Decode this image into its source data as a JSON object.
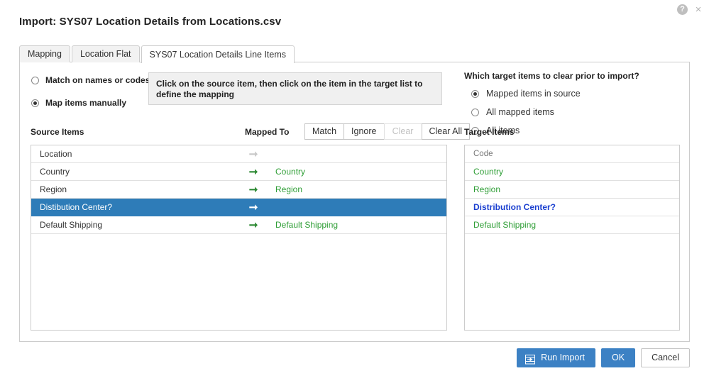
{
  "window": {
    "help_icon": "help-icon",
    "help_glyph": "?",
    "close_icon": "close-icon",
    "close_glyph": "×"
  },
  "dialog": {
    "title": "Import: SYS07 Location Details from Locations.csv"
  },
  "tabs": [
    {
      "label": "Mapping",
      "active": false
    },
    {
      "label": "Location Flat",
      "active": false
    },
    {
      "label": "SYS07 Location Details Line Items",
      "active": true
    }
  ],
  "mapping_mode": {
    "options": [
      {
        "label": "Match on names or codes",
        "selected": false
      },
      {
        "label": "Map items manually",
        "selected": true
      }
    ]
  },
  "hint": {
    "text": "Click on the source item, then click on the item in the target list to define the mapping"
  },
  "clear_options": {
    "question": "Which target items to clear prior to import?",
    "options": [
      {
        "label": "Mapped items in source",
        "selected": true
      },
      {
        "label": "All mapped items",
        "selected": false
      },
      {
        "label": "All items",
        "selected": false
      }
    ]
  },
  "columns": {
    "source_items": "Source Items",
    "mapped_to": "Mapped To",
    "target_items": "Target Items"
  },
  "map_buttons": [
    {
      "label": "Match",
      "disabled": false
    },
    {
      "label": "Ignore",
      "disabled": false
    },
    {
      "label": "Clear",
      "disabled": true
    },
    {
      "label": "Clear All",
      "disabled": false
    }
  ],
  "source_list": {
    "rows": [
      {
        "name": "Location",
        "arrow": "muted",
        "mapped": ""
      },
      {
        "name": "Country",
        "arrow": "green",
        "mapped": "Country"
      },
      {
        "name": "Region",
        "arrow": "green",
        "mapped": "Region"
      },
      {
        "name": "Distibution Center?",
        "arrow": "white",
        "mapped": "",
        "selected": true
      },
      {
        "name": "Default Shipping",
        "arrow": "green",
        "mapped": "Default Shipping"
      }
    ]
  },
  "target_list": {
    "header": "Code",
    "rows": [
      {
        "name": "Country",
        "highlight": false
      },
      {
        "name": "Region",
        "highlight": false
      },
      {
        "name": "Distribution Center?",
        "highlight": true
      },
      {
        "name": "Default Shipping",
        "highlight": false
      }
    ]
  },
  "footer": {
    "run_import": "Run Import",
    "run_import_icon": "import-icon",
    "ok": "OK",
    "cancel": "Cancel"
  },
  "colors": {
    "accent_blue": "#3c81c4",
    "selection_blue": "#2e7cb8",
    "mapped_green": "#2f9e36",
    "target_highlight_blue": "#1a3fd0",
    "panel_border": "#cccccc",
    "hint_bg": "#f0f0f0"
  }
}
